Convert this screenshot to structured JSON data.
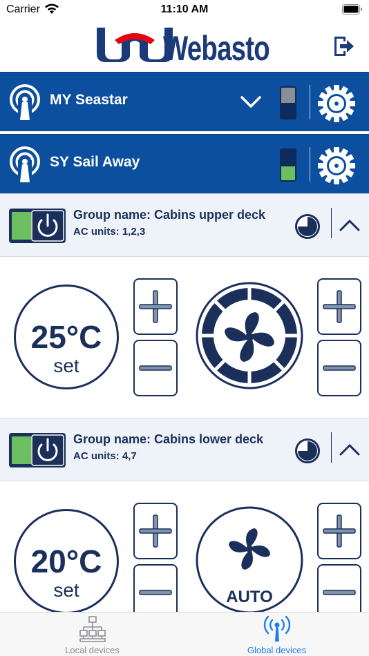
{
  "status_bar": {
    "carrier": "Carrier",
    "time": "11:10 AM"
  },
  "header": {
    "logo_text": "Webasto",
    "logo_accent_color": "#e30613",
    "brand_color": "#1b3a7a"
  },
  "vessels": [
    {
      "name": "MY Seastar",
      "icon": "signal-icon",
      "expanded": false,
      "level_top_color": "#8a8f97",
      "level_bottom_color": "#0d2b5c"
    },
    {
      "name": "SY Sail Away",
      "icon": "signal-icon",
      "level_top_color": "#0d2b5c",
      "level_bottom_color": "#6cbf5e"
    }
  ],
  "groups": [
    {
      "title": "Group name: Cabins upper deck",
      "units": "AC units: 1,2,3",
      "temperature": "25°C",
      "set_label": "set",
      "fan_mode": "",
      "power_on_color": "#6cbf5e"
    },
    {
      "title": "Group name: Cabins lower deck",
      "units": "AC units: 4,7",
      "temperature": "20°C",
      "set_label": "set",
      "fan_mode": "AUTO",
      "power_on_color": "#6cbf5e"
    }
  ],
  "tabbar": {
    "tabs": [
      {
        "label": "Local devices",
        "active": false,
        "color": "#8e8e93"
      },
      {
        "label": "Global devices",
        "active": true,
        "color": "#1a7ef0"
      }
    ]
  },
  "colors": {
    "vessel_bar": "#0d4f9f",
    "dark_navy": "#1b2f5b",
    "group_header_bg": "#eef2f9"
  }
}
